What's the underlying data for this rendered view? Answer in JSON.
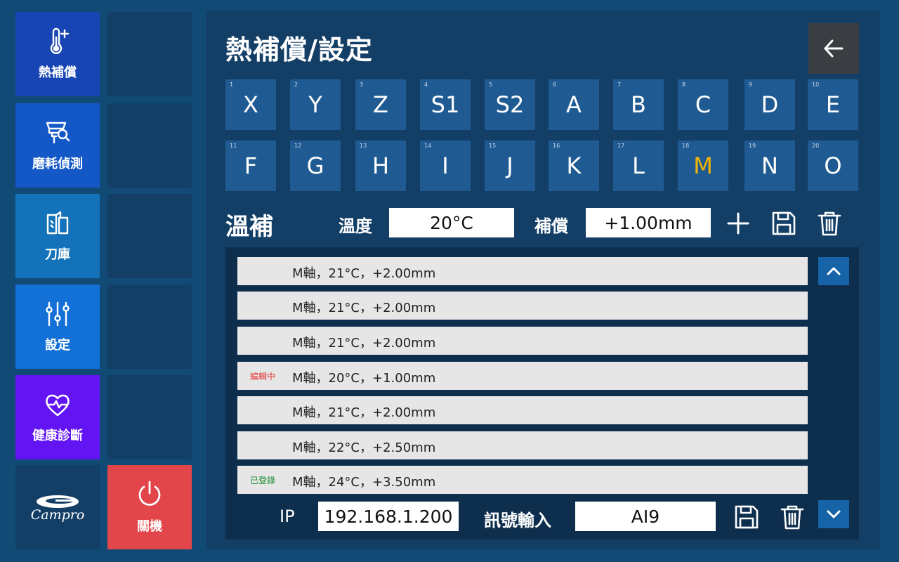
{
  "sidebar": {
    "items": [
      {
        "label": "熱補償",
        "icon": "thermometer-plus-icon",
        "color": "#1746b4"
      },
      {
        "label": "磨耗偵測",
        "icon": "wear-detect-icon",
        "color": "#1457c7"
      },
      {
        "label": "刀庫",
        "icon": "tool-magazine-icon",
        "color": "#1372ba"
      },
      {
        "label": "設定",
        "icon": "sliders-icon",
        "color": "#1270d6"
      },
      {
        "label": "健康診斷",
        "icon": "heart-pulse-icon",
        "color": "#6214f2"
      }
    ],
    "logo_text": "Campro",
    "power_label": "關機",
    "power_color": "#e2464a"
  },
  "header": {
    "title": "熱補償/設定",
    "back_icon": "arrow-left-icon"
  },
  "axis_keys": [
    {
      "num": "1",
      "label": "X"
    },
    {
      "num": "2",
      "label": "Y"
    },
    {
      "num": "3",
      "label": "Z"
    },
    {
      "num": "4",
      "label": "S1"
    },
    {
      "num": "5",
      "label": "S2"
    },
    {
      "num": "6",
      "label": "A"
    },
    {
      "num": "7",
      "label": "B"
    },
    {
      "num": "8",
      "label": "C"
    },
    {
      "num": "9",
      "label": "D"
    },
    {
      "num": "10",
      "label": "E"
    },
    {
      "num": "11",
      "label": "F"
    },
    {
      "num": "12",
      "label": "G"
    },
    {
      "num": "13",
      "label": "H"
    },
    {
      "num": "14",
      "label": "I"
    },
    {
      "num": "15",
      "label": "J"
    },
    {
      "num": "16",
      "label": "K"
    },
    {
      "num": "17",
      "label": "L"
    },
    {
      "num": "18",
      "label": "M",
      "active": true
    },
    {
      "num": "19",
      "label": "N"
    },
    {
      "num": "20",
      "label": "O"
    }
  ],
  "active_color": "#f4b400",
  "temp_comp": {
    "section_title": "溫補",
    "temp_label": "溫度",
    "temp_value": "20°C",
    "comp_label": "補償",
    "comp_value": "+1.00mm"
  },
  "entries": [
    {
      "tag": "",
      "text": "M軸，21°C，+2.00mm"
    },
    {
      "tag": "",
      "text": "M軸，21°C，+2.00mm"
    },
    {
      "tag": "",
      "text": "M軸，21°C，+2.00mm"
    },
    {
      "tag": "編輯中",
      "tag_type": "editing",
      "text": "M軸，20°C，+1.00mm"
    },
    {
      "tag": "",
      "text": "M軸，21°C，+2.00mm"
    },
    {
      "tag": "",
      "text": "M軸，22°C，+2.50mm"
    },
    {
      "tag": "已登錄",
      "tag_type": "saved",
      "text": "M軸，24°C，+3.50mm"
    }
  ],
  "footer": {
    "ip_label": "IP",
    "ip_value": "192.168.1.200",
    "signal_label": "訊號輸入",
    "signal_value": "AI9"
  }
}
